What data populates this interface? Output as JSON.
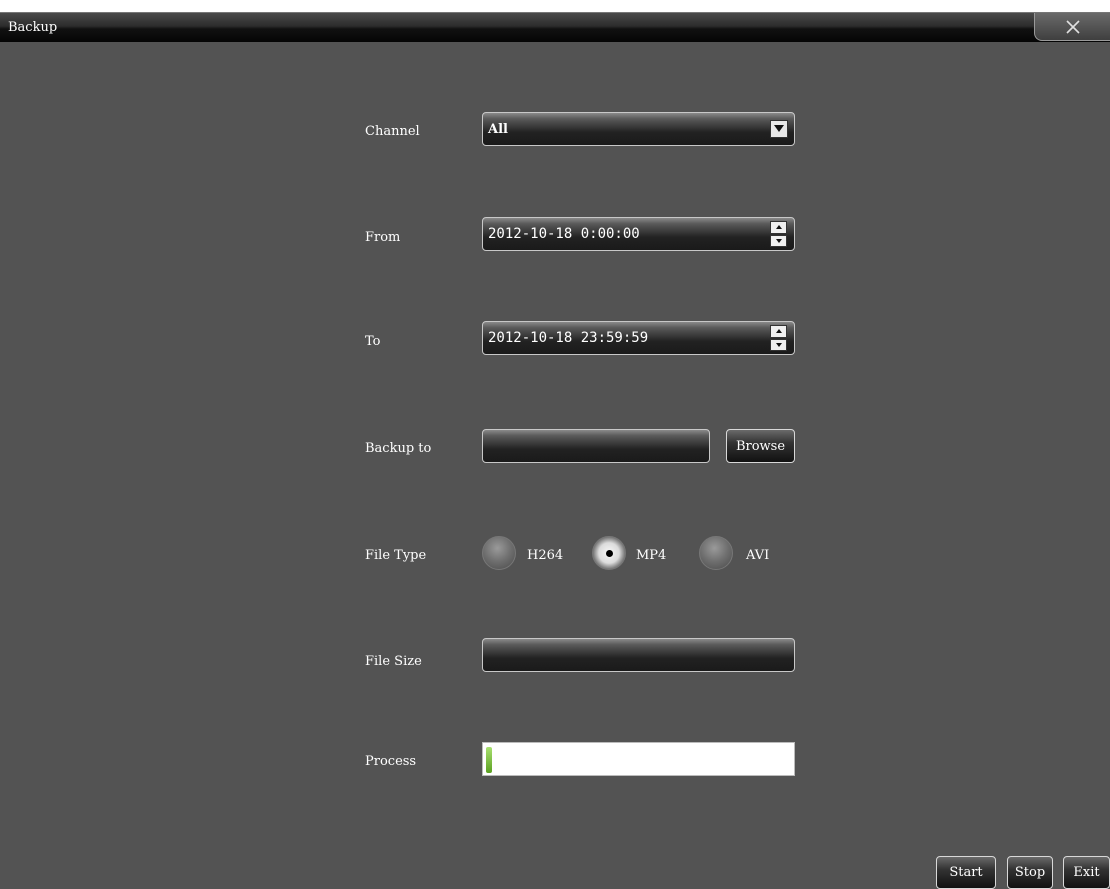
{
  "window": {
    "title": "Backup"
  },
  "form": {
    "channel": {
      "label": "Channel",
      "value": "All"
    },
    "from": {
      "label": "From",
      "value": "2012-10-18 0:00:00"
    },
    "to": {
      "label": "To",
      "value": "2012-10-18 23:59:59"
    },
    "backup_to": {
      "label": "Backup to",
      "value": "",
      "browse_label": "Browse"
    },
    "file_type": {
      "label": "File Type",
      "options": [
        "H264",
        "MP4",
        "AVI"
      ],
      "selected": "MP4"
    },
    "file_size": {
      "label": "File Size",
      "value": ""
    },
    "process": {
      "label": "Process",
      "progress": 0.02
    }
  },
  "footer": {
    "start_label": "Start",
    "stop_label": "Stop",
    "exit_label": "Exit"
  },
  "colors": {
    "background": "#535353",
    "progress_fill": "#7cc040"
  }
}
